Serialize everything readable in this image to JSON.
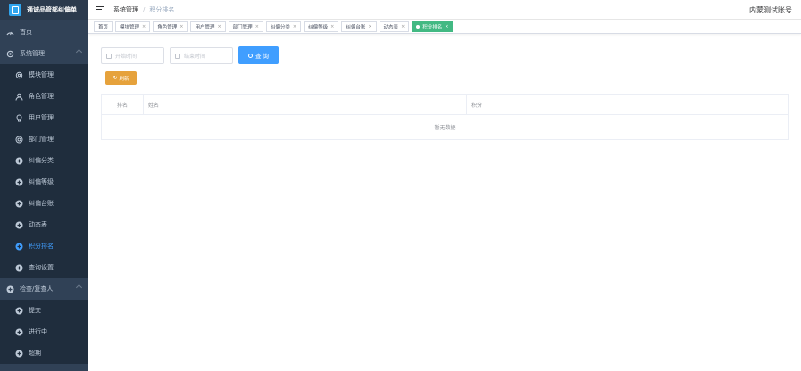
{
  "app": {
    "title": "通诚品管部纠偏单"
  },
  "sidebar": {
    "items": [
      {
        "label": "首页",
        "icon": "dashboard-icon"
      },
      {
        "label": "系统管理",
        "icon": "gear-icon"
      },
      {
        "label": "模块管理",
        "icon": "gear-icon"
      },
      {
        "label": "角色管理",
        "icon": "user-icon"
      },
      {
        "label": "用户管理",
        "icon": "lightbulb-icon"
      },
      {
        "label": "部门管理",
        "icon": "target-icon"
      },
      {
        "label": "纠偏分类",
        "icon": "plus-circle-icon"
      },
      {
        "label": "纠偏等级",
        "icon": "plus-circle-icon"
      },
      {
        "label": "纠偏台账",
        "icon": "plus-circle-icon"
      },
      {
        "label": "动态表",
        "icon": "plus-circle-icon"
      },
      {
        "label": "积分排名",
        "icon": "plus-circle-icon"
      },
      {
        "label": "查询设置",
        "icon": "plus-circle-icon"
      },
      {
        "label": "检查/复查人",
        "icon": "plus-circle-icon"
      },
      {
        "label": "提交",
        "icon": "plus-circle-icon"
      },
      {
        "label": "进行中",
        "icon": "plus-circle-icon"
      },
      {
        "label": "超期",
        "icon": "plus-circle-icon"
      }
    ]
  },
  "header": {
    "breadcrumb": [
      "系统管理",
      "积分排名"
    ],
    "account": "内蒙测试账号"
  },
  "tags": [
    {
      "label": "首页"
    },
    {
      "label": "模块管理"
    },
    {
      "label": "角色管理"
    },
    {
      "label": "用户管理"
    },
    {
      "label": "部门管理"
    },
    {
      "label": "纠偏分类"
    },
    {
      "label": "纠偏等级"
    },
    {
      "label": "纠偏台账"
    },
    {
      "label": "动态表"
    },
    {
      "label": "积分排名"
    }
  ],
  "filters": {
    "start_placeholder": "开始时间",
    "end_placeholder": "结束时间",
    "search_label": "查 询",
    "refresh_label": "刷新"
  },
  "table": {
    "columns": [
      "排名",
      "姓名",
      "积分"
    ],
    "empty_text": "暂无数据"
  },
  "colors": {
    "sidebar_bg": "#304156",
    "active_menu": "#409eff",
    "active_tag": "#42b983",
    "primary_button": "#409eff",
    "warning_button": "#e6a23c"
  }
}
